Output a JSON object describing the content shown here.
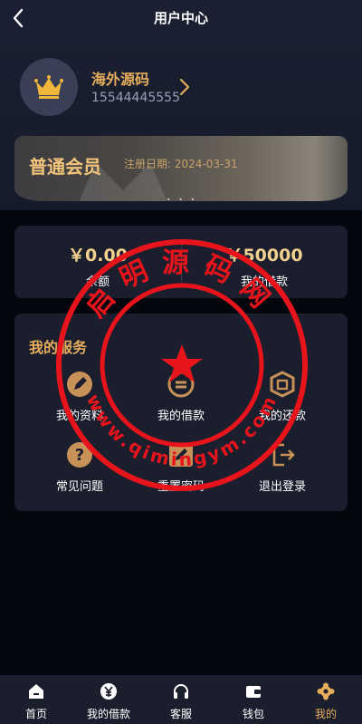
{
  "header": {
    "title": "用户中心"
  },
  "profile": {
    "name": "海外源码",
    "phone": "15544445555"
  },
  "vip": {
    "level": "普通会员",
    "register_label": "注册日期:",
    "register_date": "2024-03-31"
  },
  "balance": {
    "left": {
      "amount": "￥0.00",
      "label": "余额"
    },
    "right": {
      "amount": "￥50000",
      "label": "我的借款"
    }
  },
  "services": {
    "title": "我的服务",
    "items": [
      {
        "label": "我的资料",
        "icon": "profile-pen-icon"
      },
      {
        "label": "我的借款",
        "icon": "loan-exchange-icon"
      },
      {
        "label": "我的还款",
        "icon": "repay-shield-icon"
      },
      {
        "label": "常见问题",
        "icon": "question-icon"
      },
      {
        "label": "重置密码",
        "icon": "edit-password-icon"
      },
      {
        "label": "退出登录",
        "icon": "logout-icon"
      }
    ]
  },
  "tabbar": {
    "items": [
      {
        "label": "首页",
        "icon": "home-icon"
      },
      {
        "label": "我的借款",
        "icon": "yuan-icon"
      },
      {
        "label": "客服",
        "icon": "headset-icon"
      },
      {
        "label": "钱包",
        "icon": "wallet-icon"
      },
      {
        "label": "我的",
        "icon": "gear-icon"
      }
    ],
    "active_index": 4
  },
  "watermark": {
    "top_text": "启明源码网",
    "bottom_text": "www.qimingym.com"
  },
  "colors": {
    "accent": "#e6ad5c",
    "background": "#05070e",
    "card": "#1a1e2d",
    "stamp_red": "#e8141c"
  }
}
